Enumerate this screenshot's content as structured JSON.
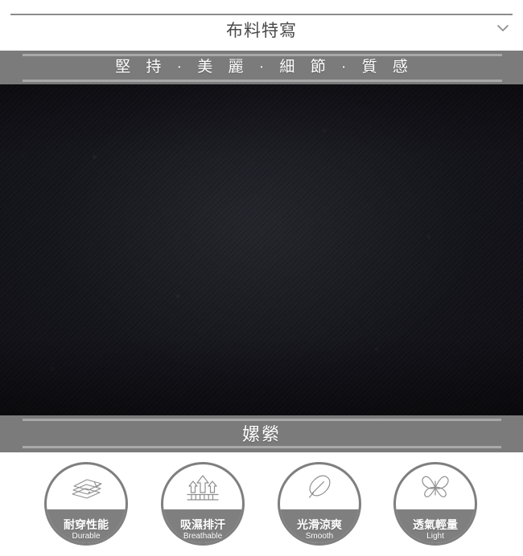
{
  "header": {
    "title": "布料特寫",
    "expand_icon": "chevron-down-icon"
  },
  "tagline_banner": {
    "text": "堅 持 · 美 麗 · 細 節 · 質 感"
  },
  "fabric_image": {
    "alt": "fabric-closeup-photo",
    "color": "#15151c"
  },
  "material_banner": {
    "text": "嫘縈"
  },
  "features": [
    {
      "icon": "fabric-layers-icon",
      "zh": "耐穿性能",
      "en": "Durable"
    },
    {
      "icon": "moisture-wicking-arrows-icon",
      "zh": "吸濕排汗",
      "en": "Breathable"
    },
    {
      "icon": "smooth-cool-feather-icon",
      "zh": "光滑涼爽",
      "en": "Smooth"
    },
    {
      "icon": "butterfly-icon",
      "zh": "透氣輕量",
      "en": "Light"
    }
  ],
  "colors": {
    "banner_gray": "#7b7b7b",
    "banner_line": "#a9a9a9",
    "badge_gray": "#7f7f7f",
    "title_text": "#4a4a4a",
    "fabric_dark": "#15151c"
  }
}
